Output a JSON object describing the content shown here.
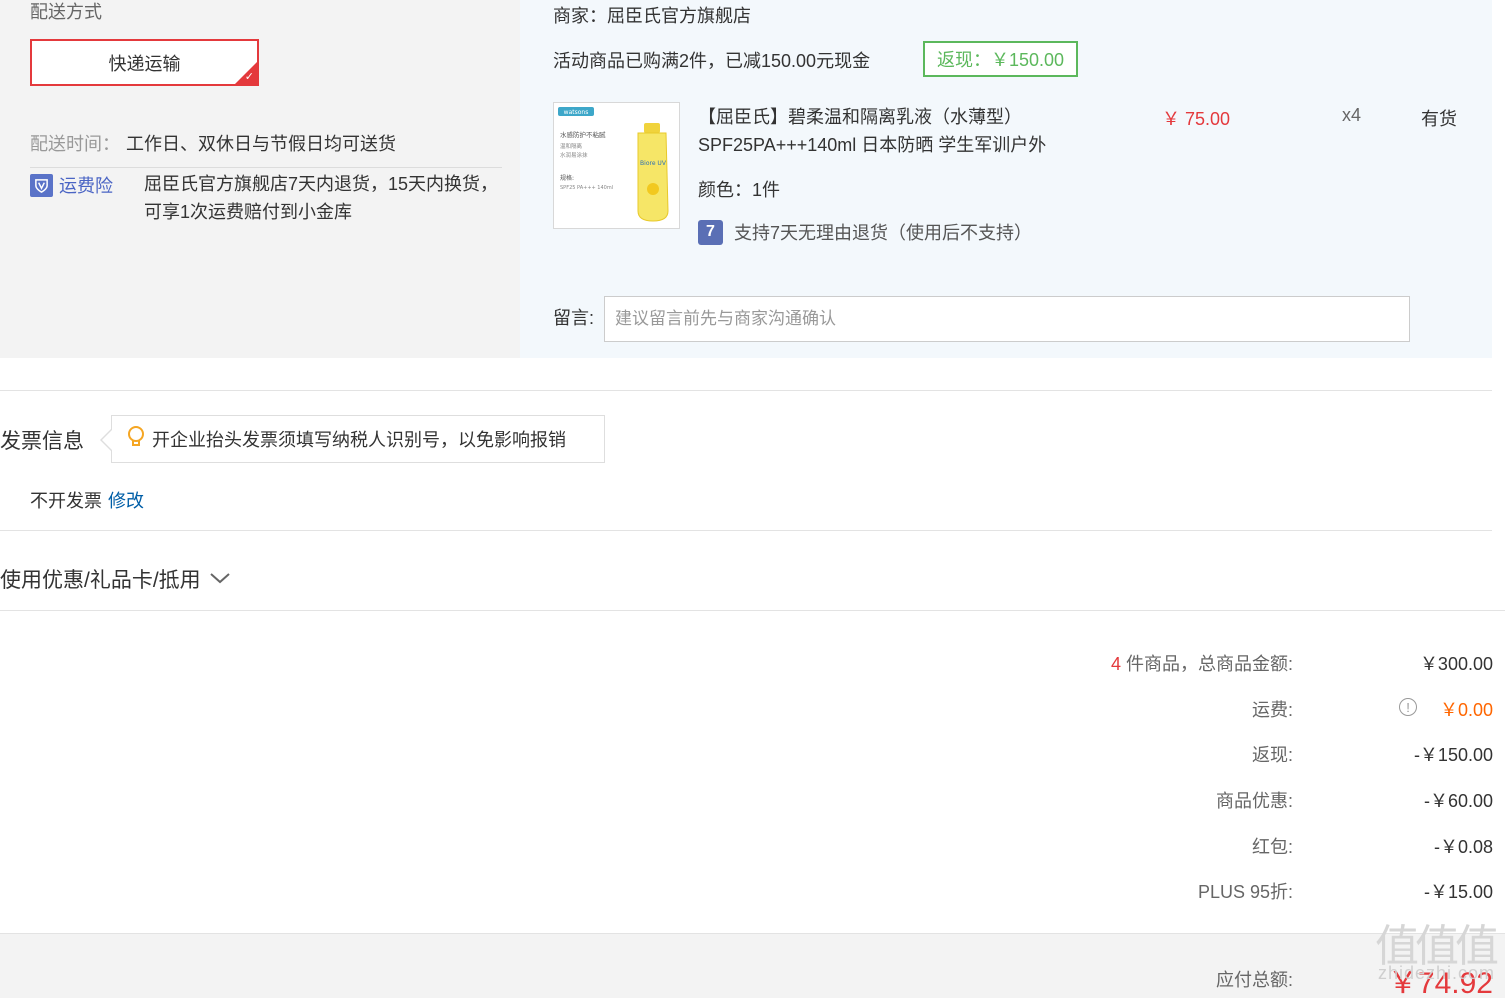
{
  "shipping": {
    "section_label": "配送方式",
    "method": "快递运输",
    "time_label": "配送时间：",
    "time_value": "工作日、双休日与节假日均可送货",
    "insurance_label": "运费险",
    "insurance_text": "屈臣氏官方旗舰店7天内退货，15天内换货，可享1次运费赔付到小金库"
  },
  "store": {
    "merchant": "商家：屈臣氏官方旗舰店",
    "promo": "活动商品已购满2件，已减150.00元现金",
    "cashback_tag": "返现：￥150.00"
  },
  "product": {
    "title": "【屈臣氏】碧柔温和隔离乳液（水薄型）SPF25PA+++140ml 日本防晒 学生军训户外",
    "price": "￥ 75.00",
    "qty": "x4",
    "stock": "有货",
    "color": "颜色：1件",
    "return_icon_text": "7",
    "return_policy": "支持7天无理由退货（使用后不支持）",
    "thumb_brand": "watsons",
    "thumb_line1": "水感防护不粘腻",
    "thumb_line2": "温和隔离",
    "thumb_line3": "水润易涂抹",
    "thumb_line4": "规格:",
    "thumb_line5": "SPF25 PA+++  140ml",
    "thumb_bottle_label": "Biore UV"
  },
  "message": {
    "label": "留言:",
    "placeholder": "建议留言前先与商家沟通确认"
  },
  "invoice": {
    "title": "发票信息",
    "tip": "开企业抬头发票须填写纳税人识别号，以免影响报销",
    "status": "不开发票",
    "edit_link": "修改"
  },
  "coupons": {
    "label": "使用优惠/礼品卡/抵用"
  },
  "summary": {
    "count": "4",
    "items_label": "件商品，总商品金额:",
    "items_value": "￥300.00",
    "shipping_label": "运费:",
    "shipping_value": "￥0.00",
    "cashback_label": "返现:",
    "cashback_value": "-￥150.00",
    "discount_label": "商品优惠:",
    "discount_value": "-￥60.00",
    "redpacket_label": "红包:",
    "redpacket_value": "-￥0.08",
    "plus_label": "PLUS 95折:",
    "plus_value": "-￥15.00",
    "total_label": "应付总额:",
    "total_value": "￥74.92"
  },
  "watermark": {
    "glyphs": "值值值",
    "text": "zhidezhi.com"
  },
  "colors": {
    "accent_red": "#e4393c",
    "link_blue": "#005ea7",
    "cashback_green": "#5cb85c",
    "orange": "#ff6600"
  }
}
